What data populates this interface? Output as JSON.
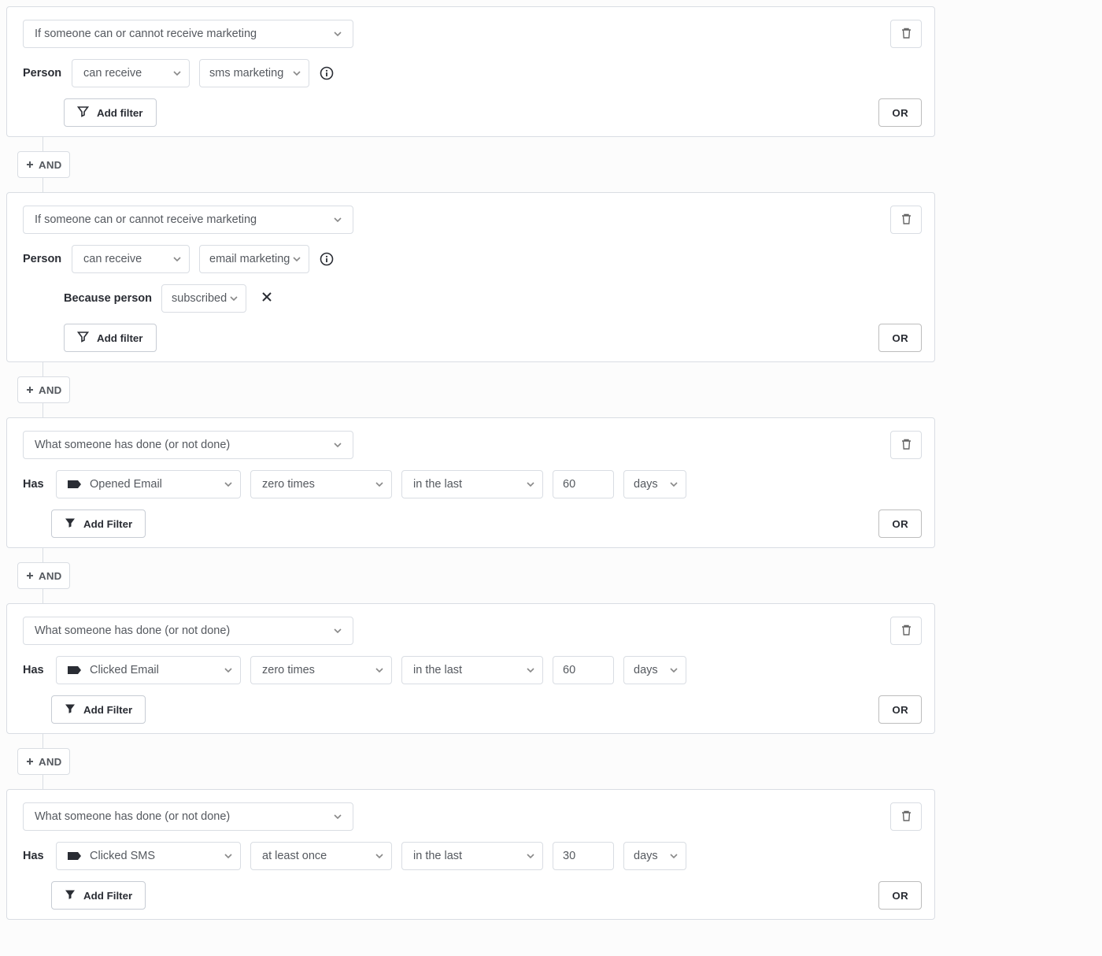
{
  "common": {
    "and_label": "AND",
    "or_label": "OR",
    "add_filter_label": "Add filter",
    "add_filter_label_cap": "Add Filter"
  },
  "conditions": [
    {
      "type_label": "If someone can or cannot receive marketing",
      "style": "marketing",
      "subject_label": "Person",
      "verb": "can receive",
      "channel": "sms marketing",
      "has_info": true,
      "because": null
    },
    {
      "type_label": "If someone can or cannot receive marketing",
      "style": "marketing",
      "subject_label": "Person",
      "verb": "can receive",
      "channel": "email marketing",
      "has_info": true,
      "because": {
        "label": "Because person",
        "value": "subscribed"
      }
    },
    {
      "type_label": "What someone has done (or not done)",
      "style": "event",
      "subject_label": "Has",
      "metric": "Opened Email",
      "count": "zero times",
      "range": "in the last",
      "amount": "60",
      "unit": "days"
    },
    {
      "type_label": "What someone has done (or not done)",
      "style": "event",
      "subject_label": "Has",
      "metric": "Clicked Email",
      "count": "zero times",
      "range": "in the last",
      "amount": "60",
      "unit": "days"
    },
    {
      "type_label": "What someone has done (or not done)",
      "style": "event",
      "subject_label": "Has",
      "metric": "Clicked SMS",
      "count": "at least once",
      "range": "in the last",
      "amount": "30",
      "unit": "days"
    }
  ]
}
